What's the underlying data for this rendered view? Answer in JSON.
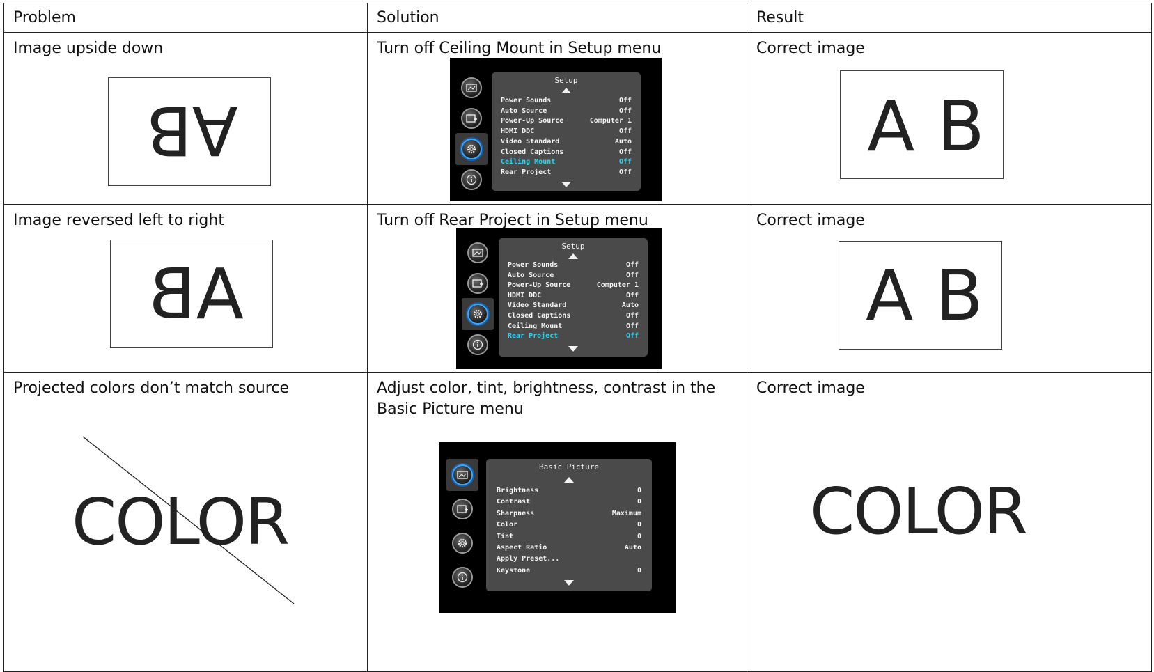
{
  "table": {
    "headers": {
      "problem": "Problem",
      "solution": "Solution",
      "result": "Result"
    },
    "rows": [
      {
        "problem": "Image upside down",
        "problem_graphic": "AB",
        "solution": "Turn off Ceiling Mount in Setup menu",
        "result": "Correct image",
        "result_graphic": "A B"
      },
      {
        "problem": "Image reversed left to right",
        "problem_graphic": "AB",
        "solution": "Turn off Rear Project in Setup menu",
        "result": "Correct image",
        "result_graphic": "A B"
      },
      {
        "problem": "Projected colors don’t match source",
        "problem_graphic": "COLOR",
        "solution": "Adjust color, tint, brightness, contrast in the Basic Picture menu",
        "result": "Correct image",
        "result_graphic": "COLOR"
      }
    ]
  },
  "menus": {
    "setup1": {
      "title": "Setup",
      "items": [
        {
          "label": "Power Sounds",
          "value": "Off"
        },
        {
          "label": "Auto Source",
          "value": "Off"
        },
        {
          "label": "Power-Up Source",
          "value": "Computer 1"
        },
        {
          "label": "HDMI DDC",
          "value": "Off"
        },
        {
          "label": "Video Standard",
          "value": "Auto"
        },
        {
          "label": "Closed Captions",
          "value": "Off"
        },
        {
          "label": "Ceiling Mount",
          "value": "Off"
        },
        {
          "label": "Rear Project",
          "value": "Off"
        }
      ],
      "selected": "Ceiling Mount"
    },
    "setup2": {
      "title": "Setup",
      "items": [
        {
          "label": "Power Sounds",
          "value": "Off"
        },
        {
          "label": "Auto Source",
          "value": "Off"
        },
        {
          "label": "Power-Up Source",
          "value": "Computer 1"
        },
        {
          "label": "HDMI DDC",
          "value": "Off"
        },
        {
          "label": "Video Standard",
          "value": "Auto"
        },
        {
          "label": "Closed Captions",
          "value": "Off"
        },
        {
          "label": "Ceiling Mount",
          "value": "Off"
        },
        {
          "label": "Rear Project",
          "value": "Off"
        }
      ],
      "selected": "Rear Project"
    },
    "basic": {
      "title": "Basic Picture",
      "items": [
        {
          "label": "Brightness",
          "value": "0"
        },
        {
          "label": "Contrast",
          "value": "0"
        },
        {
          "label": "Sharpness",
          "value": "Maximum"
        },
        {
          "label": "Color",
          "value": "0"
        },
        {
          "label": "Tint",
          "value": "0"
        },
        {
          "label": "Aspect Ratio",
          "value": "Auto"
        },
        {
          "label": "Apply Preset...",
          "value": ""
        },
        {
          "label": "Keystone",
          "value": "0"
        }
      ],
      "selected": ""
    }
  },
  "colors": {
    "selected_text": "#2fd0ee",
    "osd_panel": "#4a4a4a",
    "osd_bg": "#000000"
  },
  "icons": [
    "picture-icon",
    "picture-add-icon",
    "gear-icon",
    "info-icon"
  ]
}
